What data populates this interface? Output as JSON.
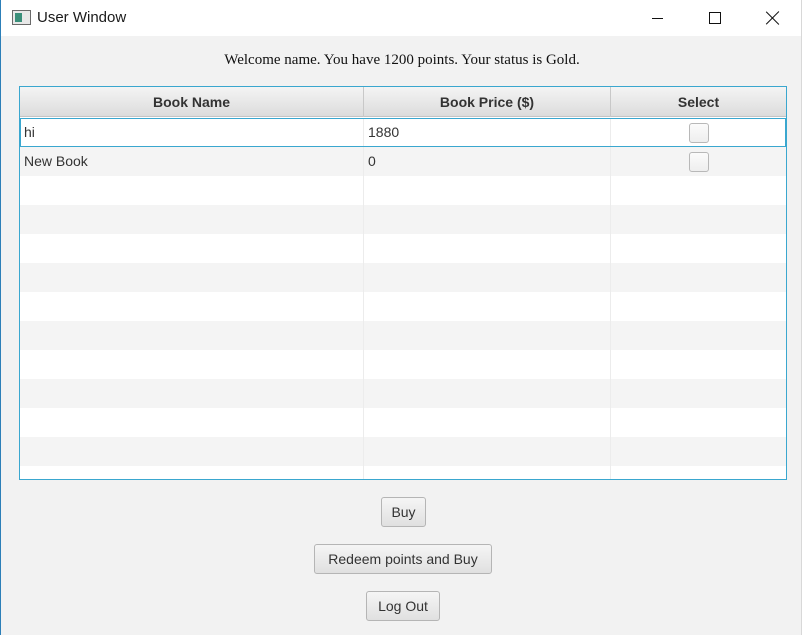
{
  "window": {
    "title": "User Window"
  },
  "welcome_text": "Welcome name. You have 1200 points. Your status is Gold.",
  "table": {
    "columns": [
      "Book Name",
      "Book Price ($)",
      "Select"
    ],
    "rows": [
      {
        "name": "hi",
        "price": "1880",
        "selected": false
      },
      {
        "name": "New Book",
        "price": "0",
        "selected": false
      }
    ]
  },
  "buttons": {
    "buy": "Buy",
    "redeem": "Redeem points and Buy",
    "logout": "Log Out"
  },
  "icons": {
    "app": "app-window-icon",
    "minimize": "minimize-icon",
    "maximize": "maximize-icon",
    "close": "close-icon"
  },
  "colors": {
    "focus_border": "#3aa7cf"
  }
}
